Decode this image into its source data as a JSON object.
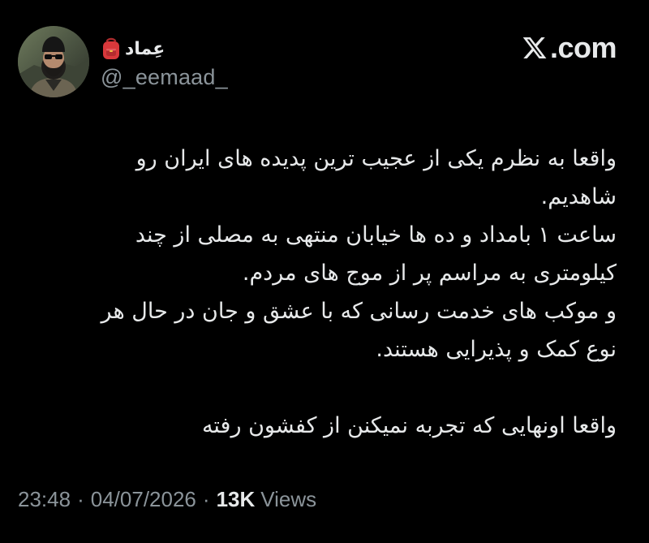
{
  "author": {
    "display_name": "عِماد",
    "badge_emoji": "backpack-icon",
    "handle": "@_eemaad_"
  },
  "brand": {
    "label": ".com",
    "icon": "x-logo-icon"
  },
  "tweet": {
    "lines": [
      "واقعا به نظرم یکی از عجیب ترین پدیده های ایران رو",
      "شاهدیم.",
      "ساعت ۱ بامداد و ده ها خیابان منتهی به مصلی از چند",
      "کیلومتری به مراسم پر از موج های مردم.",
      "و موکب های خدمت رسانی که با عشق و جان در حال هر",
      "نوع کمک و پذیرایی هستند.",
      "",
      "واقعا اونهایی که تجربه نمیکنن از کفشون رفته"
    ]
  },
  "meta": {
    "time": "23:48",
    "separator": "·",
    "date": "04/07/2026",
    "views_count": "13K",
    "views_label": "Views"
  },
  "colors": {
    "background": "#000000",
    "primary_text": "#e7e9ea",
    "secondary_text": "#8b949a",
    "badge_red": "#d8383b"
  }
}
